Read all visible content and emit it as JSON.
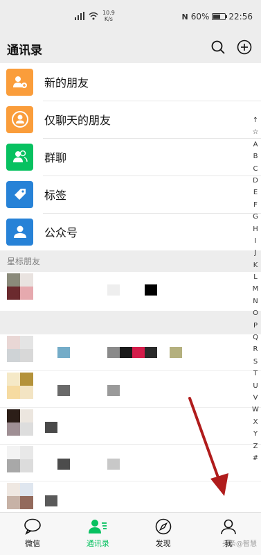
{
  "status_bar": {
    "speed_value": "10.9",
    "speed_unit": "K/s",
    "battery": "60%",
    "battery_level": 0.6,
    "time": "22:56"
  },
  "header": {
    "title": "通讯录"
  },
  "menu": [
    {
      "label": "新的朋友",
      "icon": "add-friend-icon",
      "color": "#fa9d3b"
    },
    {
      "label": "仅聊天的朋友",
      "icon": "chat-only-friend-icon",
      "color": "#fa9d3b"
    },
    {
      "label": "群聊",
      "icon": "group-chat-icon",
      "color": "#07c160"
    },
    {
      "label": "标签",
      "icon": "tag-icon",
      "color": "#2782d7"
    },
    {
      "label": "公众号",
      "icon": "official-account-icon",
      "color": "#2782d7"
    }
  ],
  "starred_section": {
    "label": "星标朋友"
  },
  "index_letters": [
    "↑",
    "☆",
    "A",
    "B",
    "C",
    "D",
    "E",
    "F",
    "G",
    "H",
    "I",
    "J",
    "K",
    "L",
    "M",
    "N",
    "O",
    "P",
    "Q",
    "R",
    "S",
    "T",
    "U",
    "V",
    "W",
    "X",
    "Y",
    "Z",
    "#"
  ],
  "tabs": [
    {
      "label": "微信",
      "icon": "chat-bubble-icon",
      "active": false
    },
    {
      "label": "通讯录",
      "icon": "contacts-icon",
      "active": true
    },
    {
      "label": "发现",
      "icon": "compass-icon",
      "active": false
    },
    {
      "label": "我",
      "icon": "person-icon",
      "active": false
    }
  ],
  "watermark": "头条@智慧"
}
